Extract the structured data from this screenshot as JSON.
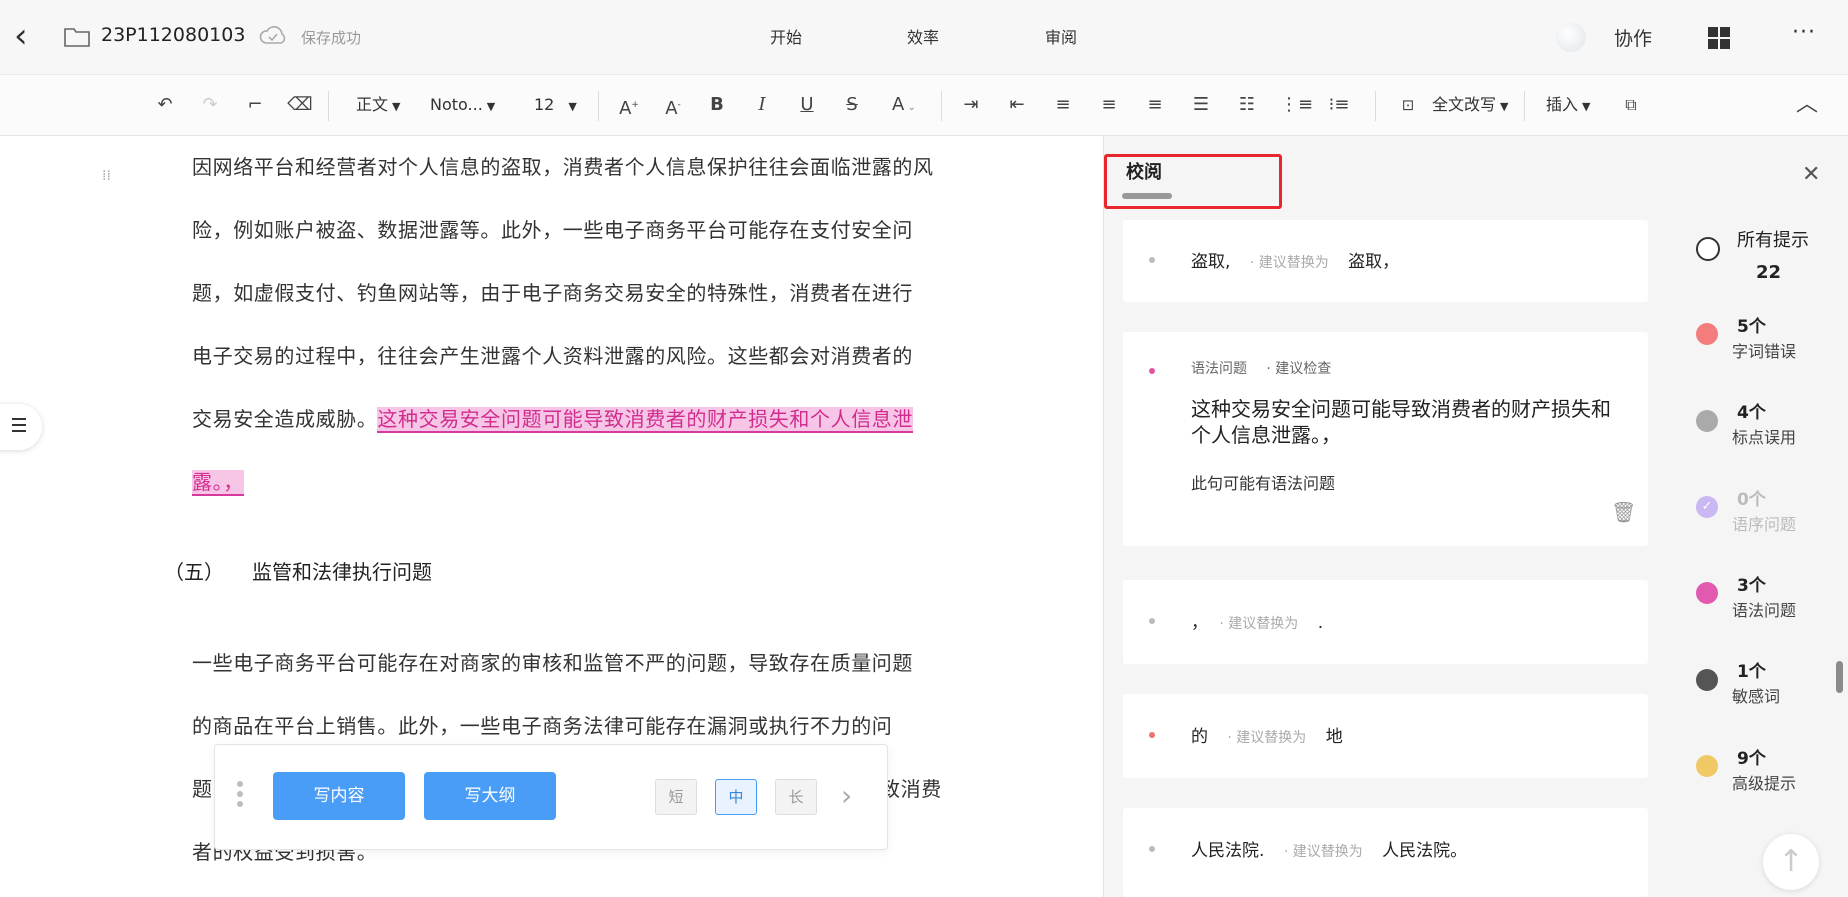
{
  "header": {
    "back_icon": "chevron-left-icon",
    "doc_name": "23P112080103",
    "save_status": "保存成功",
    "menus": [
      "开始",
      "效率",
      "审阅"
    ],
    "collab_label": "协作",
    "more_label": "···"
  },
  "toolbar": {
    "style_select": "正文",
    "font_select": "Noto...",
    "size_select": "12",
    "rewrite_label": "全文改写",
    "insert_label": "插入"
  },
  "editor": {
    "para1": [
      "因网络平台和经营者对个人信息的盗取，消费者个人信息保护往往会面临泄露的风",
      "险，例如账户被盗、数据泄露等。此外，一些电子商务平台可能存在支付安全问",
      "题，如虚假支付、钓鱼网站等，由于电子商务交易安全的特殊性，消费者在进行",
      "电子交易的过程中，往往会产生泄露个人资料泄露的风险。这些都会对消费者的"
    ],
    "para1_line5_plain": "交易安全造成威胁。",
    "para1_line5_hl": "这种交易安全问题可能导致消费者的财产损失和个人信息泄",
    "para1_line6_hl": "露。，",
    "heading_num": "（五）",
    "heading_text": "监管和法律执行问题",
    "para2": [
      "一些电子商务平台可能存在对商家的审核和监管不严的问题，导致存在质量问题",
      "的商品在平台上销售。此外，一些电子商务法律可能存在漏洞或执行不力的问",
      "题，",
      "者的权益受到损害。"
    ],
    "para2_line3_tail": "致消费"
  },
  "ai_bar": {
    "write_content": "写内容",
    "write_outline": "写大纲",
    "sizes": [
      "短",
      "中",
      "长"
    ],
    "selected_size": "中"
  },
  "panel": {
    "title": "校阅",
    "close_icon": "close-icon",
    "hint_label": "· 建议替换为",
    "cards": [
      {
        "orig": "盗取,",
        "hint": "· 建议替换为",
        "new": "盗取，",
        "dot_color": "#bbbbbb"
      },
      {
        "tag": "语法问题",
        "hint": "· 建议检查",
        "sentence": "这种交易安全问题可能导致消费者的财产损失和个人信息泄露。，",
        "note": "此句可能有语法问题",
        "dot_color": "#e0549e"
      },
      {
        "orig": "，",
        "hint": "· 建议替换为",
        "new": ".",
        "dot_color": "#bbbbbb"
      },
      {
        "orig": "的",
        "hint": "· 建议替换为",
        "new": "地",
        "dot_color": "#f07070"
      },
      {
        "orig": "人民法院.",
        "hint": "· 建议替换为",
        "new": "人民法院。",
        "dot_color": "#bbbbbb"
      }
    ]
  },
  "stats": {
    "all_label": "所有提示",
    "all_count": "22",
    "items": [
      {
        "count": "5个",
        "label": "字词错误",
        "color": "#f47c7c"
      },
      {
        "count": "4个",
        "label": "标点误用",
        "color": "#aaaaaa"
      },
      {
        "count": "0个",
        "label": "语序问题",
        "color": "#c9b8f3"
      },
      {
        "count": "3个",
        "label": "语法问题",
        "color": "#e25aaf"
      },
      {
        "count": "1个",
        "label": "敏感词",
        "color": "#555555"
      },
      {
        "count": "9个",
        "label": "高级提示",
        "color": "#f0c866"
      }
    ]
  }
}
